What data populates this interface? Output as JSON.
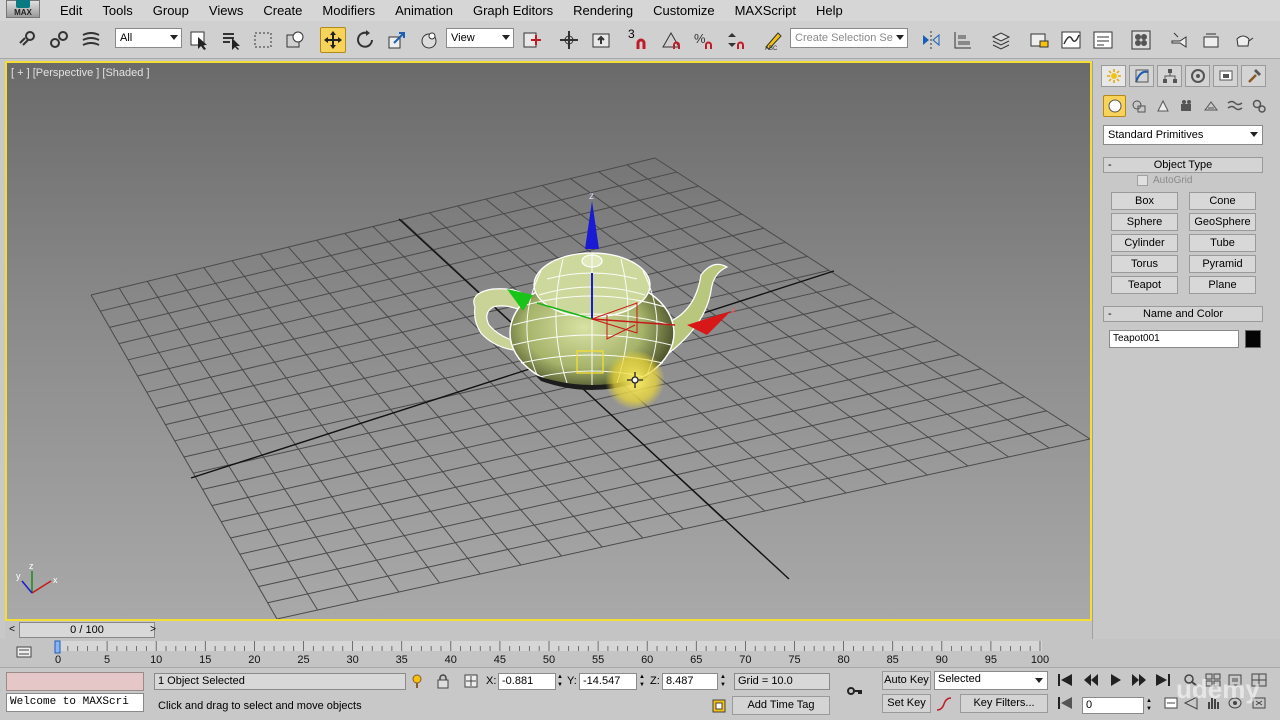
{
  "menu": {
    "logo_text": "MAX",
    "items": [
      "Edit",
      "Tools",
      "Group",
      "Views",
      "Create",
      "Modifiers",
      "Animation",
      "Graph Editors",
      "Rendering",
      "Customize",
      "MAXScript",
      "Help"
    ]
  },
  "toolbar": {
    "selection_filter": "All",
    "reference_coord": "View",
    "snap_label": "3",
    "named_selection_placeholder": "Create Selection Se",
    "active_tool": "select-and-move"
  },
  "viewport": {
    "label": "[ + ] [Perspective ] [Shaded ]",
    "axis_x": "x",
    "axis_y": "y",
    "axis_z": "z",
    "gizmo_z": "z",
    "gizmo_x": "x",
    "highlight_color": "#f4dd35"
  },
  "command_panel": {
    "category": "Standard Primitives",
    "object_type_title": "Object Type",
    "autogrid_label": "AutoGrid",
    "buttons": [
      "Box",
      "Cone",
      "Sphere",
      "GeoSphere",
      "Cylinder",
      "Tube",
      "Torus",
      "Pyramid",
      "Teapot",
      "Plane"
    ],
    "name_color_title": "Name and Color",
    "object_name": "Teapot001",
    "object_color": "#050505"
  },
  "time": {
    "frame_display": "0 / 100",
    "ruler_ticks": [
      "0",
      "5",
      "10",
      "15",
      "20",
      "25",
      "30",
      "35",
      "40",
      "45",
      "50",
      "55",
      "60",
      "65",
      "70",
      "75",
      "80",
      "85",
      "90",
      "95",
      "100"
    ]
  },
  "status": {
    "maxscript_text": "Welcome to MAXScri",
    "selection_info": "1 Object Selected",
    "prompt": "Click and drag to select and move objects",
    "x_label": "X:",
    "x_value": "-0.881",
    "y_label": "Y:",
    "y_value": "-14.547",
    "z_label": "Z:",
    "z_value": "8.487",
    "grid": "Grid = 10.0",
    "add_time_tag": "Add Time Tag",
    "auto_key": "Auto Key",
    "set_key": "Set Key",
    "key_mode": "Selected",
    "key_filters": "Key Filters...",
    "current_frame": "0",
    "watermark": "udemy"
  }
}
